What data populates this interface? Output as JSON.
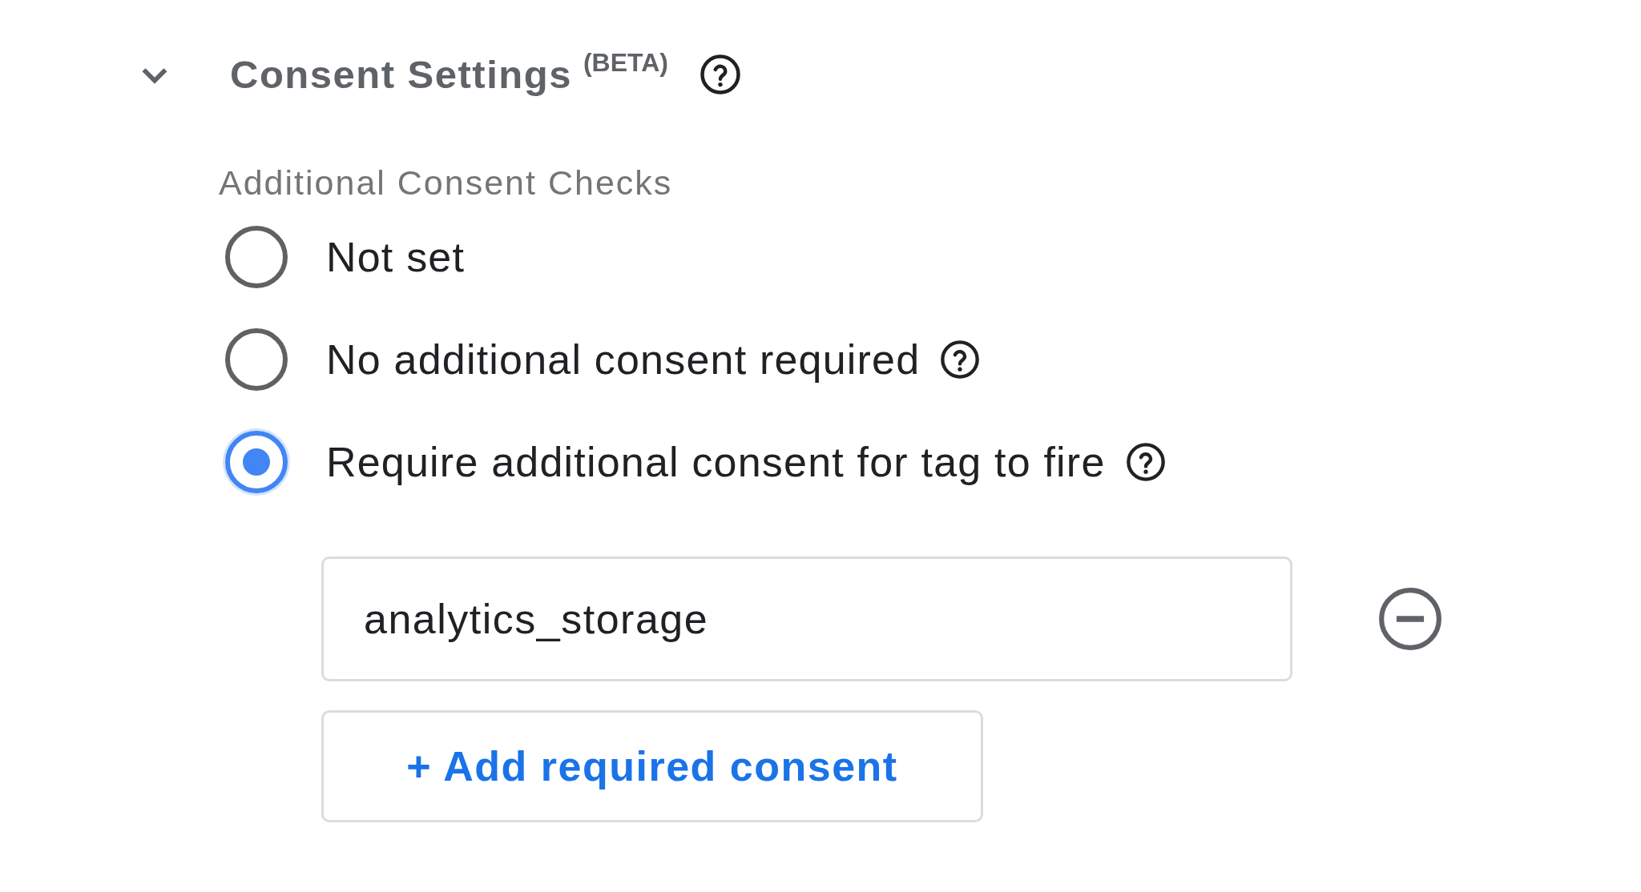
{
  "section": {
    "title": "Consent Settings",
    "badge": "(BETA)",
    "expanded": true
  },
  "consent_checks": {
    "label": "Additional Consent Checks",
    "options": [
      {
        "label": "Not set",
        "selected": false,
        "help": false
      },
      {
        "label": "No additional consent required",
        "selected": false,
        "help": true
      },
      {
        "label": "Require additional consent for tag to fire",
        "selected": true,
        "help": true
      }
    ]
  },
  "required_consents": [
    {
      "value": "analytics_storage"
    }
  ],
  "add_button": {
    "label": "+ Add required consent"
  }
}
